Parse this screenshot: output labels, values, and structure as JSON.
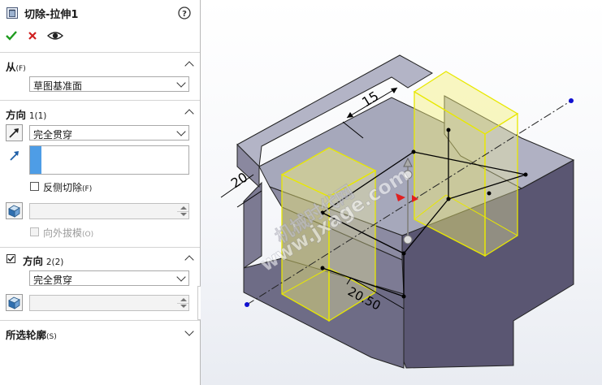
{
  "panel": {
    "title": "切除-拉伸1",
    "help_icon": "help-icon",
    "actions": {
      "ok": "checkmark-icon",
      "cancel": "close-icon",
      "preview": "eye-icon"
    },
    "from": {
      "title": "从",
      "hotkey": "(F)",
      "value": "草图基准面"
    },
    "direction1": {
      "title": "方向",
      "title_suffix": "1(1)",
      "end_condition": "完全贯穿",
      "flip_side_label": "反侧切除",
      "flip_side_hotkey": "(F)",
      "draft_label": "向外拔模",
      "draft_hotkey": "(O)"
    },
    "direction2": {
      "title": "方向",
      "title_suffix": "2(2)",
      "checked": true,
      "end_condition": "完全贯穿"
    },
    "selected_contours": {
      "title": "所选轮廓",
      "hotkey": "(S)"
    }
  },
  "viewport": {
    "dimensions": [
      "15",
      "20",
      "20.50"
    ],
    "watermark_cn": "机械时代网",
    "watermark_url": "www.jxage.com",
    "colors": {
      "part_top": "#a8a9bd",
      "part_side": "#56536e",
      "preview_outline": "#e8e800",
      "axis_point": "#1010d0"
    }
  }
}
